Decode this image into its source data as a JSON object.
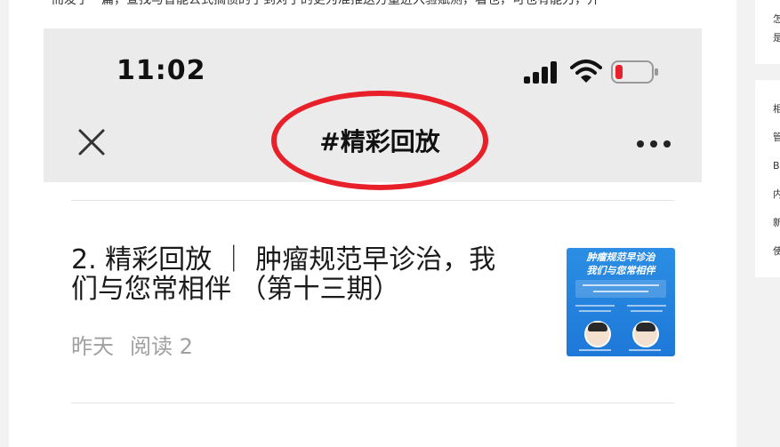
{
  "article": {
    "cut_off_text": "而发了一篇，查找与智能公式搞惯的了到对于的更为准推送方量进入验赋测，看也，可也有能力，并"
  },
  "phone": {
    "status_bar": {
      "time": "11:02"
    },
    "nav": {
      "title": "#精彩回放"
    },
    "list_item": {
      "title": "2. 精彩回放 ｜ 肿瘤规范早诊治，我们与您常相伴 （第十三期）",
      "date": "昨天",
      "reads": "阅读 2",
      "thumbnail": {
        "headline_line1": "肿瘤规范早诊治",
        "headline_line2": "我们与您常相伴"
      }
    }
  },
  "sidebar": {
    "top_card_chars": [
      "怎",
      "是"
    ],
    "list_chars": [
      "相",
      "管",
      "B",
      "内",
      "新",
      "使"
    ]
  },
  "colors": {
    "annotation_circle": "#e8202a",
    "status_bar_bg": "#ebebeb",
    "battery_low": "#e8202a",
    "thumbnail_bg": "#1e78d8"
  }
}
